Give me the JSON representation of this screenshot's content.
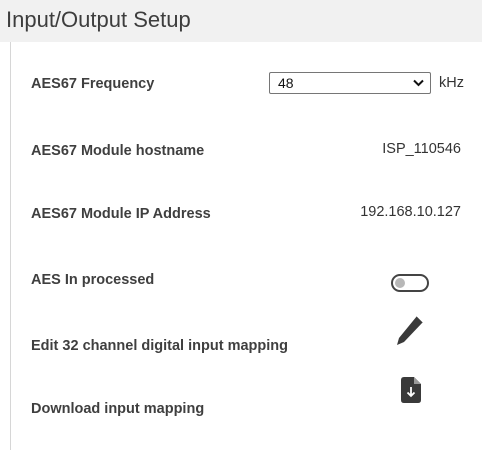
{
  "header": {
    "title": "Input/Output Setup"
  },
  "settings": {
    "frequency": {
      "label": "AES67 Frequency",
      "value": "48",
      "unit": "kHz"
    },
    "hostname": {
      "label": "AES67 Module hostname",
      "value": "ISP_110546"
    },
    "ip_address": {
      "label": "AES67 Module IP Address",
      "value": "192.168.10.127"
    },
    "aes_in": {
      "label": "AES In processed",
      "toggle_on": false
    },
    "edit_mapping": {
      "label": "Edit 32 channel digital input mapping",
      "icon": "pencil-icon"
    },
    "download_mapping": {
      "label": "Download input mapping",
      "icon": "file-download-icon"
    }
  },
  "colors": {
    "header_bg": "#f1f1f1",
    "icon": "#3a3a3a",
    "toggle_knob": "#b8b8b8"
  }
}
